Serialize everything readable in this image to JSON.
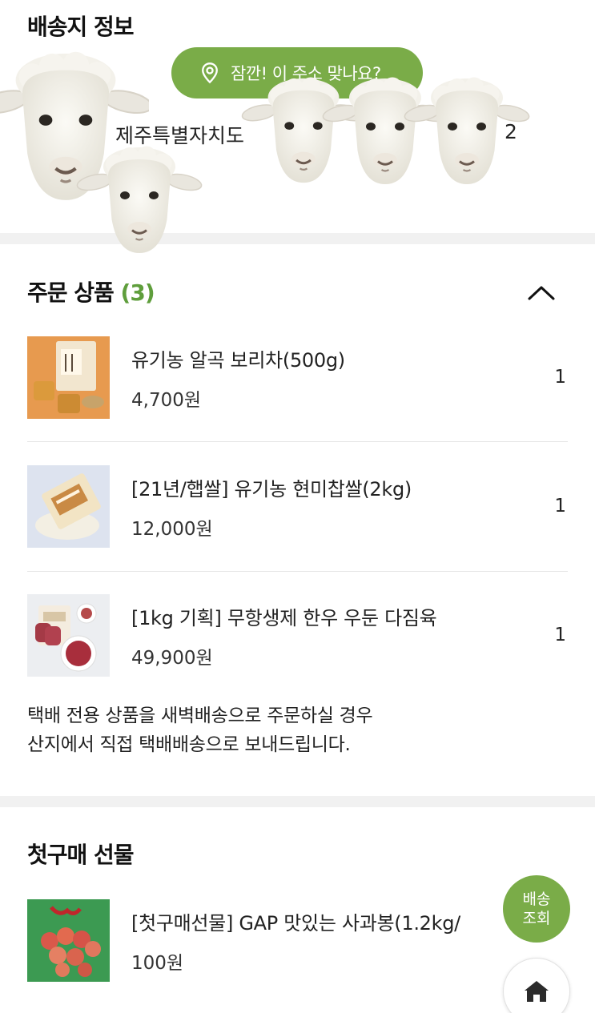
{
  "shipping": {
    "title": "배송지 정보",
    "tooltip": "잠깐! 이 주소 맞나요?",
    "address_start": "제주특별자치도",
    "address_end": "2"
  },
  "order": {
    "title": "주문 상품",
    "count": "(3)",
    "items": [
      {
        "name": "유기농 알곡 보리차(500g)",
        "price": "4,700원",
        "qty": "1"
      },
      {
        "name": "[21년/햅쌀] 유기농 현미찹쌀(2kg)",
        "price": "12,000원",
        "qty": "1"
      },
      {
        "name": "[1kg 기획] 무항생제 한우 우둔 다짐육",
        "price": "49,900원",
        "qty": "1"
      }
    ],
    "notice_line1": "택배 전용 상품을 새벽배송으로 주문하실 경우",
    "notice_line2": "산지에서 직접 택배배송으로 보내드립니다."
  },
  "gift": {
    "title": "첫구매 선물",
    "item": {
      "name": "[첫구매선물] GAP 맛있는 사과봉(1.2kg/",
      "price": "100원"
    }
  },
  "fab": {
    "delivery_line1": "배송",
    "delivery_line2": "조회"
  },
  "colors": {
    "accent": "#7aac48",
    "count": "#5f9e3c",
    "band": "#f1f1f1"
  },
  "icons": [
    "location-pin-icon",
    "chevron-up-icon",
    "home-icon"
  ]
}
